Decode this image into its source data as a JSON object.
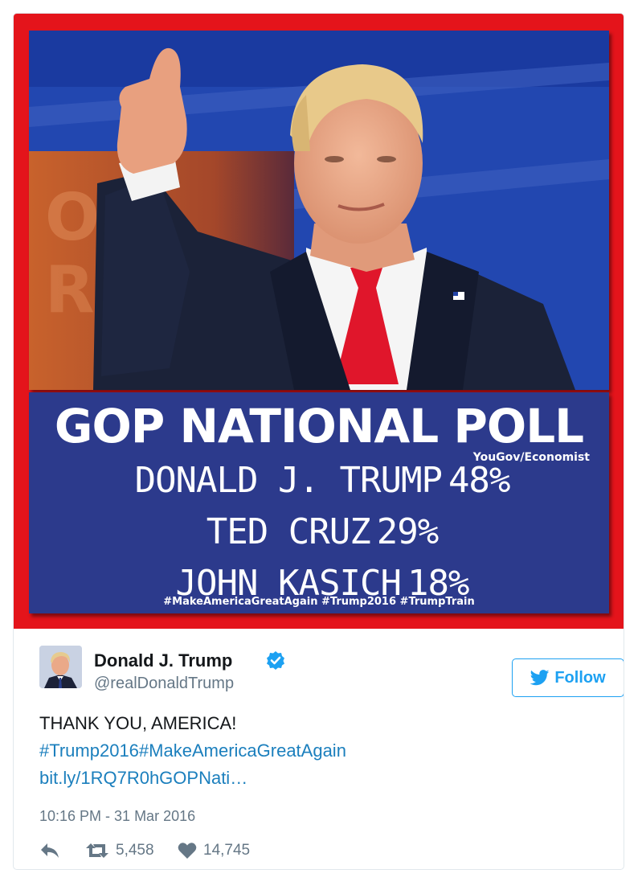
{
  "tweet": {
    "author": {
      "name": "Donald J. Trump",
      "handle": "@realDonaldTrump",
      "verified": true
    },
    "follow_label": "Follow",
    "text": {
      "line1": "THANK YOU, AMERICA!",
      "line2": "#Trump2016#MakeAmericaGreatAgain",
      "line3": "bit.ly/1RQ7R0hGOPNati…"
    },
    "timestamp": "10:16 PM - 31 Mar 2016",
    "retweets": "5,458",
    "likes": "14,745"
  },
  "media": {
    "poll_title": "GOP NATIONAL POLL",
    "poll_source": "YouGov/Economist",
    "results": [
      {
        "name": "DONALD J. TRUMP",
        "percent": "48%"
      },
      {
        "name": "TED CRUZ",
        "percent": "29%"
      },
      {
        "name": "JOHN KASICH",
        "percent": "18%"
      }
    ],
    "hashtags": "#MakeAmericaGreatAgain #Trump2016 #TrumpTrain"
  },
  "colors": {
    "frame_red": "#e4141b",
    "panel_blue": "#2c3a8c",
    "link_blue": "#1b7fbd",
    "twitter_blue": "#1da1f2",
    "meta_gray": "#657786"
  },
  "icons": [
    "verified-badge-icon",
    "twitter-bird-icon",
    "reply-icon",
    "retweet-icon",
    "heart-icon"
  ]
}
